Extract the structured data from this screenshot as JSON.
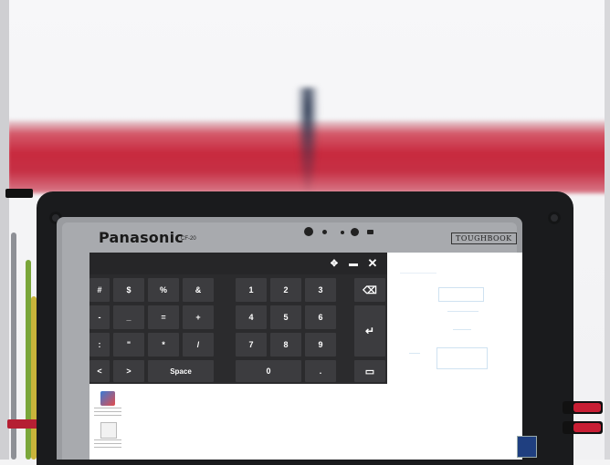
{
  "device": {
    "brand": "Panasonic",
    "model": "CF-20",
    "logo": "TOUGHBOOK"
  },
  "keyboard": {
    "controls": {
      "move": "✥",
      "dock": "▬",
      "close": "✕"
    },
    "symbol_keys": [
      {
        "name": "key-hash",
        "label": "#"
      },
      {
        "name": "key-dollar",
        "label": "$"
      },
      {
        "name": "key-percent",
        "label": "%"
      },
      {
        "name": "key-ampersand",
        "label": "&"
      },
      {
        "name": "key-minus",
        "label": "-"
      },
      {
        "name": "key-underscore",
        "label": "_"
      },
      {
        "name": "key-equals",
        "label": "="
      },
      {
        "name": "key-plus",
        "label": "+"
      },
      {
        "name": "key-colon",
        "label": ":"
      },
      {
        "name": "key-quote",
        "label": "\""
      },
      {
        "name": "key-asterisk",
        "label": "*"
      },
      {
        "name": "key-slash",
        "label": "/"
      },
      {
        "name": "key-left",
        "label": "<"
      },
      {
        "name": "key-right",
        "label": ">"
      },
      {
        "name": "key-space",
        "label": "Space"
      }
    ],
    "number_keys": [
      {
        "name": "key-1",
        "label": "1"
      },
      {
        "name": "key-2",
        "label": "2"
      },
      {
        "name": "key-3",
        "label": "3"
      },
      {
        "name": "key-4",
        "label": "4"
      },
      {
        "name": "key-5",
        "label": "5"
      },
      {
        "name": "key-6",
        "label": "6"
      },
      {
        "name": "key-7",
        "label": "7"
      },
      {
        "name": "key-8",
        "label": "8"
      },
      {
        "name": "key-9",
        "label": "9"
      },
      {
        "name": "key-0",
        "label": "0"
      },
      {
        "name": "key-dot",
        "label": "."
      }
    ],
    "action_keys": {
      "backspace": "⌫",
      "enter": "↵",
      "keyboard": "▭"
    }
  },
  "colors": {
    "keyboard_bg": "#2b2b2d",
    "key_bg": "#3c3c3f",
    "accent_red": "#c82a3e"
  }
}
